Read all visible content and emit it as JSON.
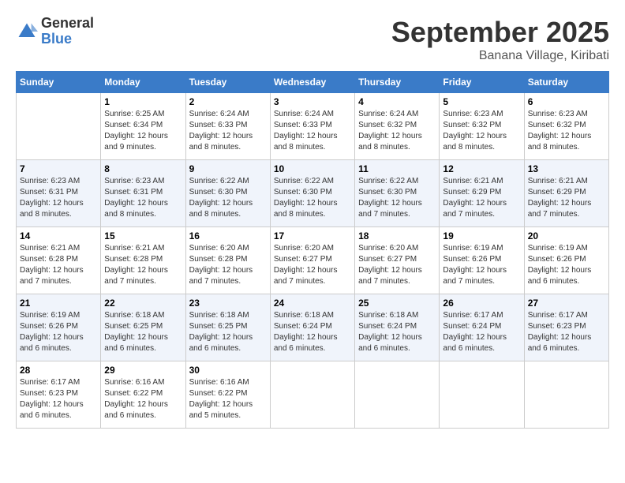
{
  "header": {
    "logo_general": "General",
    "logo_blue": "Blue",
    "month_title": "September 2025",
    "location": "Banana Village, Kiribati"
  },
  "days_of_week": [
    "Sunday",
    "Monday",
    "Tuesday",
    "Wednesday",
    "Thursday",
    "Friday",
    "Saturday"
  ],
  "weeks": [
    [
      {
        "day": "",
        "info": ""
      },
      {
        "day": "1",
        "info": "Sunrise: 6:25 AM\nSunset: 6:34 PM\nDaylight: 12 hours\nand 9 minutes."
      },
      {
        "day": "2",
        "info": "Sunrise: 6:24 AM\nSunset: 6:33 PM\nDaylight: 12 hours\nand 8 minutes."
      },
      {
        "day": "3",
        "info": "Sunrise: 6:24 AM\nSunset: 6:33 PM\nDaylight: 12 hours\nand 8 minutes."
      },
      {
        "day": "4",
        "info": "Sunrise: 6:24 AM\nSunset: 6:32 PM\nDaylight: 12 hours\nand 8 minutes."
      },
      {
        "day": "5",
        "info": "Sunrise: 6:23 AM\nSunset: 6:32 PM\nDaylight: 12 hours\nand 8 minutes."
      },
      {
        "day": "6",
        "info": "Sunrise: 6:23 AM\nSunset: 6:32 PM\nDaylight: 12 hours\nand 8 minutes."
      }
    ],
    [
      {
        "day": "7",
        "info": "Sunrise: 6:23 AM\nSunset: 6:31 PM\nDaylight: 12 hours\nand 8 minutes."
      },
      {
        "day": "8",
        "info": "Sunrise: 6:23 AM\nSunset: 6:31 PM\nDaylight: 12 hours\nand 8 minutes."
      },
      {
        "day": "9",
        "info": "Sunrise: 6:22 AM\nSunset: 6:30 PM\nDaylight: 12 hours\nand 8 minutes."
      },
      {
        "day": "10",
        "info": "Sunrise: 6:22 AM\nSunset: 6:30 PM\nDaylight: 12 hours\nand 8 minutes."
      },
      {
        "day": "11",
        "info": "Sunrise: 6:22 AM\nSunset: 6:30 PM\nDaylight: 12 hours\nand 7 minutes."
      },
      {
        "day": "12",
        "info": "Sunrise: 6:21 AM\nSunset: 6:29 PM\nDaylight: 12 hours\nand 7 minutes."
      },
      {
        "day": "13",
        "info": "Sunrise: 6:21 AM\nSunset: 6:29 PM\nDaylight: 12 hours\nand 7 minutes."
      }
    ],
    [
      {
        "day": "14",
        "info": "Sunrise: 6:21 AM\nSunset: 6:28 PM\nDaylight: 12 hours\nand 7 minutes."
      },
      {
        "day": "15",
        "info": "Sunrise: 6:21 AM\nSunset: 6:28 PM\nDaylight: 12 hours\nand 7 minutes."
      },
      {
        "day": "16",
        "info": "Sunrise: 6:20 AM\nSunset: 6:28 PM\nDaylight: 12 hours\nand 7 minutes."
      },
      {
        "day": "17",
        "info": "Sunrise: 6:20 AM\nSunset: 6:27 PM\nDaylight: 12 hours\nand 7 minutes."
      },
      {
        "day": "18",
        "info": "Sunrise: 6:20 AM\nSunset: 6:27 PM\nDaylight: 12 hours\nand 7 minutes."
      },
      {
        "day": "19",
        "info": "Sunrise: 6:19 AM\nSunset: 6:26 PM\nDaylight: 12 hours\nand 7 minutes."
      },
      {
        "day": "20",
        "info": "Sunrise: 6:19 AM\nSunset: 6:26 PM\nDaylight: 12 hours\nand 6 minutes."
      }
    ],
    [
      {
        "day": "21",
        "info": "Sunrise: 6:19 AM\nSunset: 6:26 PM\nDaylight: 12 hours\nand 6 minutes."
      },
      {
        "day": "22",
        "info": "Sunrise: 6:18 AM\nSunset: 6:25 PM\nDaylight: 12 hours\nand 6 minutes."
      },
      {
        "day": "23",
        "info": "Sunrise: 6:18 AM\nSunset: 6:25 PM\nDaylight: 12 hours\nand 6 minutes."
      },
      {
        "day": "24",
        "info": "Sunrise: 6:18 AM\nSunset: 6:24 PM\nDaylight: 12 hours\nand 6 minutes."
      },
      {
        "day": "25",
        "info": "Sunrise: 6:18 AM\nSunset: 6:24 PM\nDaylight: 12 hours\nand 6 minutes."
      },
      {
        "day": "26",
        "info": "Sunrise: 6:17 AM\nSunset: 6:24 PM\nDaylight: 12 hours\nand 6 minutes."
      },
      {
        "day": "27",
        "info": "Sunrise: 6:17 AM\nSunset: 6:23 PM\nDaylight: 12 hours\nand 6 minutes."
      }
    ],
    [
      {
        "day": "28",
        "info": "Sunrise: 6:17 AM\nSunset: 6:23 PM\nDaylight: 12 hours\nand 6 minutes."
      },
      {
        "day": "29",
        "info": "Sunrise: 6:16 AM\nSunset: 6:22 PM\nDaylight: 12 hours\nand 6 minutes."
      },
      {
        "day": "30",
        "info": "Sunrise: 6:16 AM\nSunset: 6:22 PM\nDaylight: 12 hours\nand 5 minutes."
      },
      {
        "day": "",
        "info": ""
      },
      {
        "day": "",
        "info": ""
      },
      {
        "day": "",
        "info": ""
      },
      {
        "day": "",
        "info": ""
      }
    ]
  ]
}
